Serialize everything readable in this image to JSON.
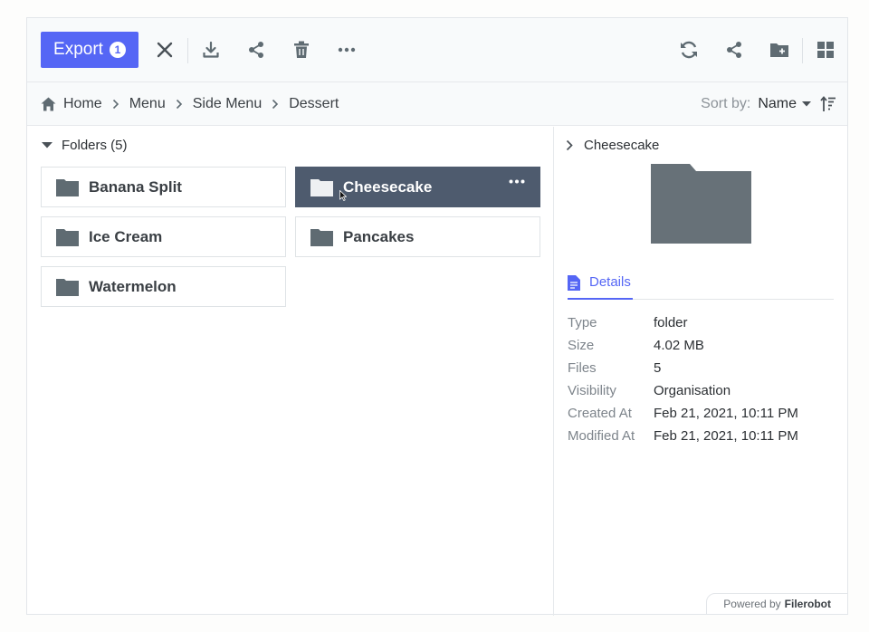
{
  "toolbar": {
    "export_label": "Export",
    "export_count": "1",
    "icons": [
      "close-icon",
      "download-icon",
      "share-icon",
      "trash-icon",
      "more-icon",
      "refresh-icon",
      "share-icon",
      "new-folder-icon",
      "grid-view-icon"
    ]
  },
  "breadcrumb": {
    "items": [
      "Home",
      "Menu",
      "Side Menu",
      "Dessert"
    ]
  },
  "sort": {
    "label": "Sort by:",
    "value": "Name"
  },
  "folders": {
    "heading": "Folders (5)",
    "items": [
      {
        "name": "Banana Split",
        "selected": false
      },
      {
        "name": "Cheesecake",
        "selected": true
      },
      {
        "name": "Ice Cream",
        "selected": false
      },
      {
        "name": "Pancakes",
        "selected": false
      },
      {
        "name": "Watermelon",
        "selected": false
      }
    ]
  },
  "preview": {
    "title": "Cheesecake",
    "tab_label": "Details",
    "details": [
      {
        "key": "Type",
        "value": "folder"
      },
      {
        "key": "Size",
        "value": "4.02 MB"
      },
      {
        "key": "Files",
        "value": "5"
      },
      {
        "key": "Visibility",
        "value": "Organisation"
      },
      {
        "key": "Created At",
        "value": "Feb 21, 2021, 10:11 PM"
      },
      {
        "key": "Modified At",
        "value": "Feb 21, 2021, 10:11 PM"
      }
    ]
  },
  "footer": {
    "powered_by": "Powered by",
    "brand": "Filerobot"
  },
  "colors": {
    "accent": "#5566f5",
    "selected": "#4e5b6e",
    "icon": "#5f6b72"
  }
}
